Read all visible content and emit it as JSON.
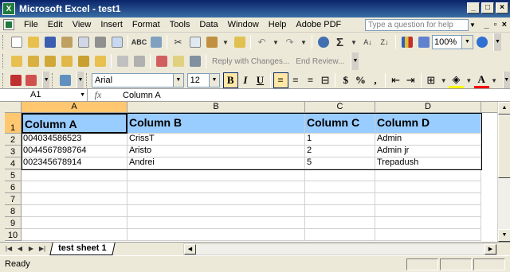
{
  "window": {
    "title": "Microsoft Excel - test1",
    "app_icon": "X"
  },
  "menu": {
    "items": [
      "File",
      "Edit",
      "View",
      "Insert",
      "Format",
      "Tools",
      "Data",
      "Window",
      "Help",
      "Adobe PDF"
    ],
    "help_placeholder": "Type a question for help"
  },
  "toolbar": {
    "zoom": "100%",
    "reply_with_changes": "Reply with Changes...",
    "end_review": "End Review...",
    "font_name": "Arial",
    "font_size": "12",
    "bold": "B",
    "italic": "I",
    "underline": "U",
    "currency": "$",
    "percent": "%",
    "comma": ","
  },
  "formula_bar": {
    "name_box": "A1",
    "fx": "fx",
    "content": "Column A"
  },
  "grid": {
    "columns": [
      "A",
      "B",
      "C",
      "D"
    ],
    "rows": [
      "1",
      "2",
      "3",
      "4",
      "5",
      "6",
      "7",
      "8",
      "9",
      "10"
    ],
    "header_row": [
      "Column A",
      "Column B",
      "Column C",
      "Column D"
    ],
    "data_rows": [
      [
        "004034586523",
        "CrissT",
        "1",
        "Admin"
      ],
      [
        "0044567898764",
        "Aristo",
        "2",
        "Admin jr"
      ],
      [
        "002345678914",
        "Andrei",
        "5",
        "Trepadush"
      ]
    ],
    "header_fill": "#99ccff",
    "selected_cell": "A1"
  },
  "sheet_tabs": [
    "test sheet 1"
  ],
  "status": {
    "text": "Ready"
  }
}
